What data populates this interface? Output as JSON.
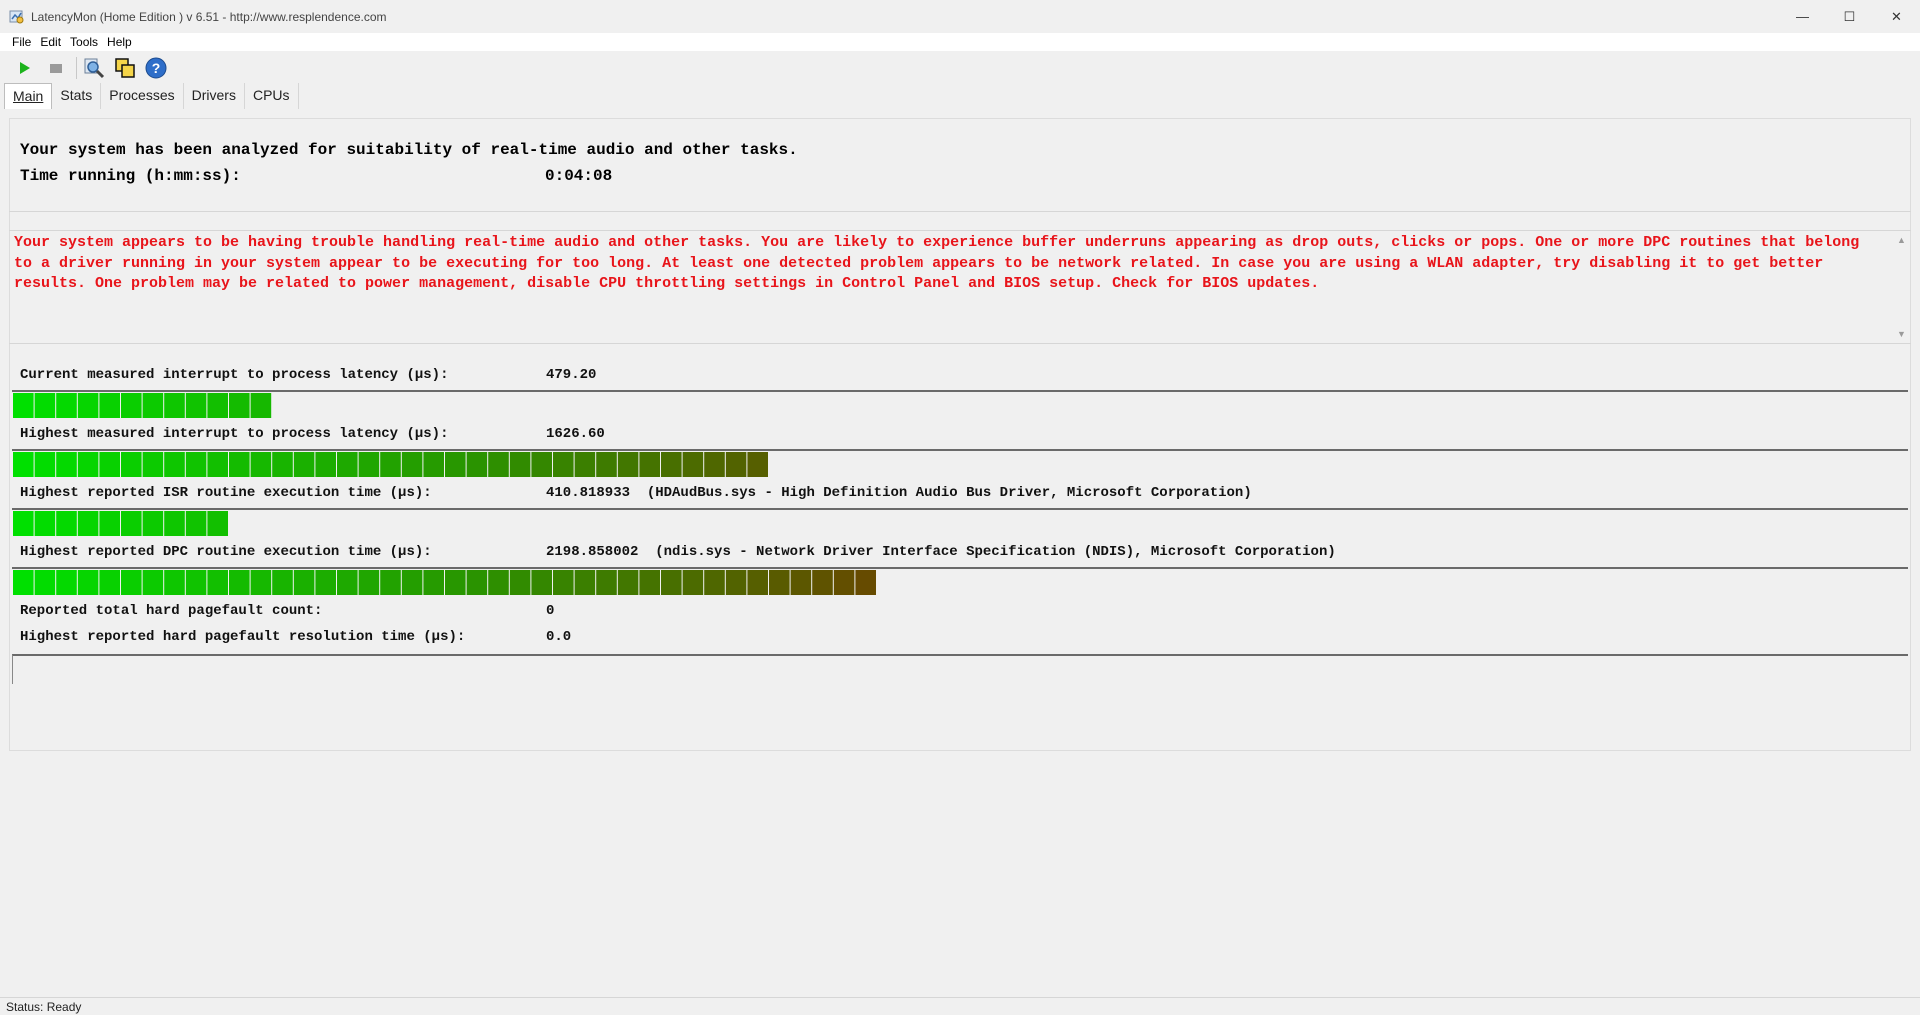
{
  "window": {
    "title": "LatencyMon  (Home Edition )  v 6.51 - http://www.resplendence.com",
    "minimize_glyph": "—",
    "maximize_glyph": "☐",
    "close_glyph": "✕"
  },
  "menu": {
    "file": "File",
    "edit": "Edit",
    "tools": "Tools",
    "help": "Help"
  },
  "toolbar": {
    "start_icon": "play-icon",
    "stop_icon": "stop-icon",
    "driver_icon": "magnifier-icon",
    "windows_icon": "windows-icon",
    "help_icon": "help-icon"
  },
  "tabs": [
    {
      "label": "Main"
    },
    {
      "label": "Stats"
    },
    {
      "label": "Processes"
    },
    {
      "label": "Drivers"
    },
    {
      "label": "CPUs"
    }
  ],
  "summary": {
    "analyzed": "Your system has been analyzed for suitability of real-time audio and other tasks.",
    "time_label": "Time running (h:mm:ss):",
    "time_value": "0:04:08"
  },
  "warning": {
    "text": "Your system appears to be having trouble handling real-time audio and other tasks. You are likely to experience buffer underruns appearing as drop outs, clicks or pops. One or more DPC routines that belong to a driver running in your system appear to be executing for too long. At least one detected problem appears to be network related. In case you are using a WLAN adapter, try disabling it to get better results. One problem may be related to power management, disable CPU throttling settings in Control Panel and BIOS setup. Check for BIOS updates.",
    "color": "#e8141a"
  },
  "stats": {
    "current_label": "Current measured interrupt to process latency (µs):",
    "current_value": "479.20",
    "highest_label": "Highest measured interrupt to process latency (µs):",
    "highest_value": "1626.60",
    "isr_label": "Highest reported ISR routine execution time (µs):",
    "isr_value": "410.818933",
    "isr_detail": "(HDAudBus.sys - High Definition Audio Bus Driver, Microsoft Corporation)",
    "dpc_label": "Highest reported DPC routine execution time (µs):",
    "dpc_value": "2198.858002",
    "dpc_detail": "(ndis.sys - Network Driver Interface Specification (NDIS), Microsoft Corporation)",
    "pagefault_label": "Reported total hard pagefault count:",
    "pagefault_value": "0",
    "pagefault_time_label": "Highest reported hard pagefault resolution time (µs):",
    "pagefault_time_value": "0.0"
  },
  "bars": {
    "current_blocks": 12,
    "highest_blocks": 35,
    "isr_blocks": 10,
    "dpc_blocks": 40,
    "start_color": "#00e000",
    "end_color": "#7a3300"
  },
  "status": {
    "text": "Status: Ready"
  }
}
